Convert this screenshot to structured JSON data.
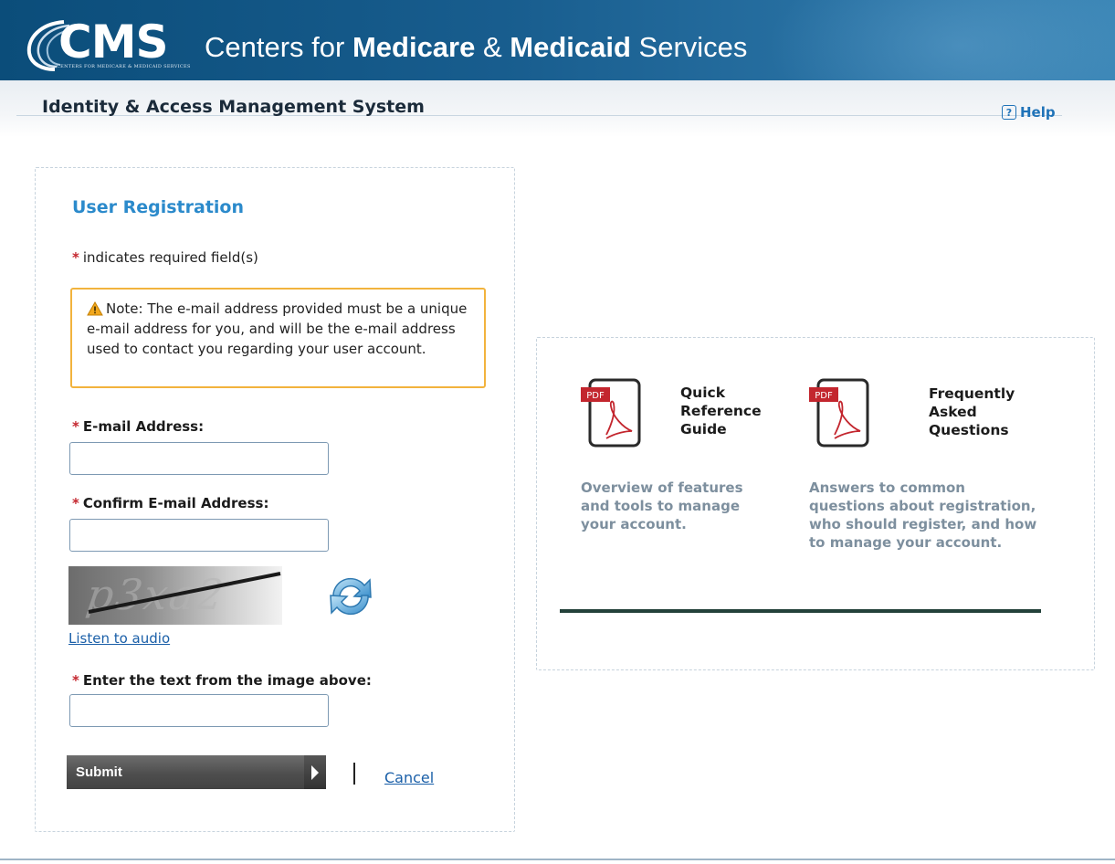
{
  "banner": {
    "logo_text": "CMS",
    "logo_subtext": "CENTERS FOR MEDICARE & MEDICAID SERVICES",
    "agency_prefix": "Centers for ",
    "agency_bold1": "Medicare",
    "agency_amp": " & ",
    "agency_bold2": "Medicaid",
    "agency_suffix": " Services"
  },
  "header": {
    "system_title": "Identity & Access Management System",
    "help_icon_glyph": "?",
    "help_label": "Help"
  },
  "registration": {
    "title": "User Registration",
    "required_marker": "*",
    "required_note": "indicates required field(s)",
    "note": "Note: The e-mail address provided must be a unique e-mail address for you, and will be the e-mail address used to contact you regarding your user account.",
    "fields": {
      "email_label": "E-mail Address:",
      "email_value": "",
      "confirm_label": "Confirm E-mail Address:",
      "confirm_value": "",
      "captcha_image_text": "p3xa2",
      "listen_audio": "Listen to audio",
      "captcha_label": "Enter the text from the image above:",
      "captcha_value": ""
    },
    "submit_label": "Submit",
    "cancel_label": "Cancel"
  },
  "resources": {
    "items": [
      {
        "icon": "pdf-icon",
        "badge": "PDF",
        "title_lines": [
          "Quick",
          "Reference",
          "Guide"
        ],
        "description": "Overview of features and tools to manage your account."
      },
      {
        "icon": "pdf-icon",
        "badge": "PDF",
        "title_lines": [
          "Frequently",
          "Asked",
          "Questions"
        ],
        "description": "Answers to common questions about registration, who should register, and how to manage your account."
      }
    ]
  },
  "colors": {
    "banner": "#185d8e",
    "link": "#1a5fa8",
    "heading_blue": "#2b8acb",
    "required": "#c4262e",
    "note_border": "#f2b33d",
    "muted_text": "#7d8f9e"
  }
}
